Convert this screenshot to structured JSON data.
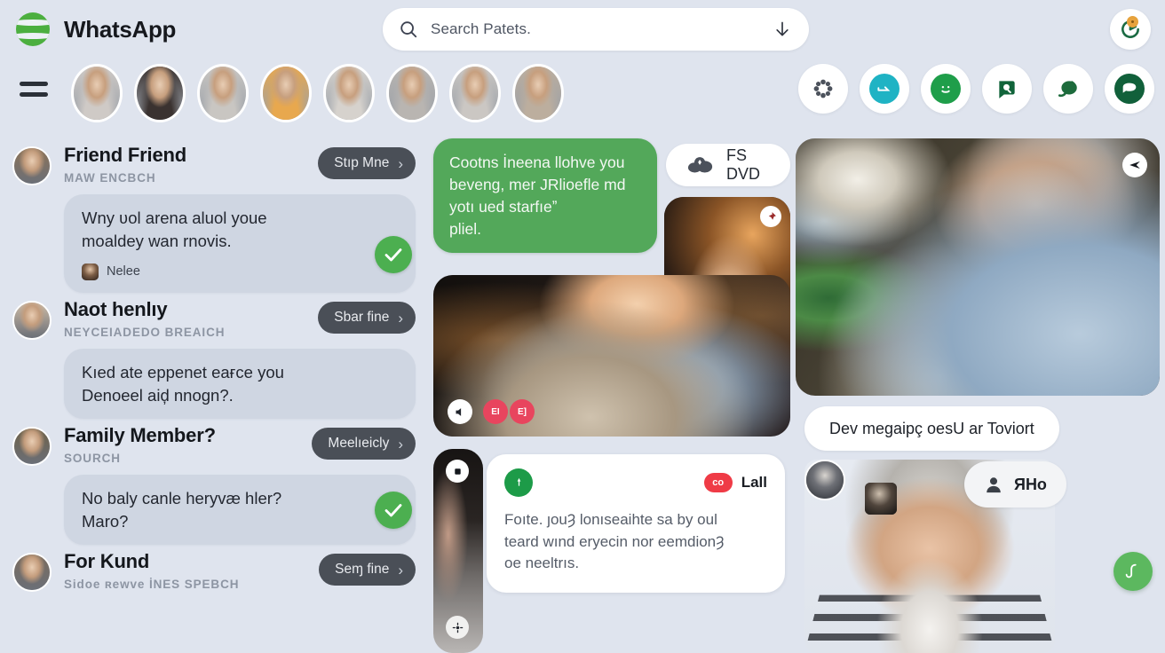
{
  "app": {
    "title": "WhatsApp",
    "logo_icon": "whatsapp-green-circle-logo",
    "bg_color": "#dfe4ee",
    "accent_green": "#4caf50",
    "bubble_green": "#53a85a"
  },
  "search": {
    "value": "Search Patets.",
    "placeholder": "Search Patets.",
    "left_icon": "search-icon",
    "right_icon": "download-arrow-icon"
  },
  "profile_button": {
    "icon": "profile-status-icon",
    "badge_color": "#e6a23c",
    "has_badge": true
  },
  "menu": {
    "icon": "hamburger-menu-icon"
  },
  "stories": [
    {
      "name": "story-1",
      "tone": "#cfcac6"
    },
    {
      "name": "story-2",
      "tone": "#3a3230"
    },
    {
      "name": "story-3",
      "tone": "#c9c6c2"
    },
    {
      "name": "story-4",
      "tone": "#e8a84e"
    },
    {
      "name": "story-5",
      "tone": "#d6d2cd"
    },
    {
      "name": "story-6",
      "tone": "#b9b5b1"
    },
    {
      "name": "story-7",
      "tone": "#cbc7c3"
    },
    {
      "name": "story-8",
      "tone": "#bcae9e"
    }
  ],
  "quick_actions": [
    {
      "name": "flower-dots-icon",
      "style": "plain",
      "color": "#4c525c"
    },
    {
      "name": "bookmark-teal-icon",
      "style": "filled",
      "color": "#1fb3c4"
    },
    {
      "name": "smiley-face-icon",
      "style": "filled",
      "color": "#1f9e4a"
    },
    {
      "name": "search-chat-icon",
      "style": "plain",
      "color": "#11643a"
    },
    {
      "name": "leaf-blob-icon",
      "style": "plain",
      "color": "#1d6b3c"
    },
    {
      "name": "chat-heart-icon",
      "style": "filled",
      "color": "#11603a"
    }
  ],
  "chats": [
    {
      "name": "Friend Friend",
      "subtitle": "MAW ENCBCH",
      "action_label": "Stıp Mne",
      "message_lines": [
        "Wny ʋol arena aluol youe",
        "moaldey wan rnovis."
      ],
      "footer_label": "Nelee",
      "has_footer": true,
      "has_check": true,
      "avatar_tone": "#8c7358"
    },
    {
      "name": "Naot henlıy",
      "subtitle": "NEYCEIADEDO BREAICH",
      "action_label": "Sbar fine",
      "message_lines": [
        "Kıed ate eppenet eaғce you",
        "Denoeel aiḑ nnogn?."
      ],
      "footer_label": "",
      "has_footer": false,
      "has_check": false,
      "avatar_tone": "#cdbba6"
    },
    {
      "name": "Family Member?",
      "subtitle": "SOURCH",
      "action_label": "Meelıeicly",
      "message_lines": [
        "No baly canle heryvæ hler?",
        "Maro?"
      ],
      "footer_label": "",
      "has_footer": false,
      "has_check": true,
      "avatar_tone": "#6e6149"
    },
    {
      "name": "For Kund",
      "subtitle": "Sidoe ʀewve İNES SPEBCH",
      "action_label": "Seɱ fine",
      "message_lines": [],
      "footer_label": "",
      "has_footer": false,
      "has_check": false,
      "avatar_tone": "#7a6c5e"
    }
  ],
  "middle": {
    "outgoing_bubble": {
      "lines": [
        "Cootns İneena llohve you",
        "beveng, mer JRlioefle md",
        "yotı ued starfıeˮ",
        "pliel."
      ]
    },
    "media_pill": {
      "icon": "cloud-photos-icon",
      "label": "FS DVD"
    },
    "photo_main": {
      "name": "cafe-woman-photo",
      "pin_badge": "pin-icon",
      "footer_icons": [
        "mute-icon",
        "badge-1",
        "badge-2"
      ]
    },
    "photo_strip": {
      "name": "side-photo-strip",
      "top_icon": "stop-icon",
      "bottom_icon": "settings-icon"
    },
    "note_card": {
      "avatar_icon": "contact-green-icon",
      "badge_text": "co",
      "badge_label": "Lall",
      "lines": [
        "Foıte. ȷouȜ lonıseaihte sa by oul",
        "teard wınd eryecin nor eemdionȜ",
        "oe neeltrıs."
      ]
    }
  },
  "right": {
    "photo_top": {
      "name": "man-at-table-photo",
      "close_icon": "close-x-icon"
    },
    "caption_pill": {
      "text": "Dev megaipç oesU ar Toviort"
    },
    "mini_avatars": [
      {
        "name": "mini-avatar-1",
        "tone": "#4a4f58"
      },
      {
        "name": "mini-avatar-2",
        "tone": "#2e2b29"
      }
    ],
    "person_pill": {
      "icon": "person-silhouette-icon",
      "label": "ЯНo"
    },
    "photo_bottom": {
      "name": "woman-with-cup-photo"
    },
    "fab": {
      "icon": "compose-chat-icon"
    }
  }
}
